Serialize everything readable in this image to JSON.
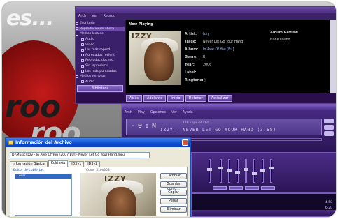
{
  "wallpaper": {
    "text_top": "es...",
    "text_mid": "roo",
    "text_low": "roo"
  },
  "player": {
    "menu": [
      "Arch",
      "Ver",
      "Reprod"
    ],
    "tree": [
      "Escritorio",
      "Reproduciendo ahora",
      "Medios locales",
      "Audio",
      "Vídeo",
      "Los más reprod.",
      "Agregados recient.",
      "Reproducidos rec.",
      "Sin reproducir",
      "Los más puntuados",
      "Medios remotos",
      "Audio"
    ],
    "tree_button": "Biblioteca",
    "now_playing": "Now Playing",
    "cover_title": "IZZY",
    "info": [
      {
        "k": "Artist:",
        "v": "Izzy"
      },
      {
        "k": "Track:",
        "v": "Never Let Go Your Hand"
      },
      {
        "k": "Album:",
        "v": "In Awe Of You [Bu]"
      },
      {
        "k": "Genre:",
        "v": "R"
      },
      {
        "k": "Year:",
        "v": "2006"
      },
      {
        "k": "Label:",
        "v": ""
      },
      {
        "k": "Ringtone:",
        "v": ""
      }
    ],
    "review_label": "Album Review",
    "review_value": "None Found",
    "controls": [
      "Atrás",
      "Adelante",
      "Inicio",
      "Detener",
      "Actualizar"
    ]
  },
  "winamp": {
    "menu": [
      "Arch",
      "Play",
      "Opciones",
      "Ver",
      "Ayuda"
    ],
    "time": "-0:N",
    "kbps": "128 kbps  44 khz",
    "marquee": "IZZY - NEVER LET GO YOUR HAND  (3:58)"
  },
  "playlist": {
    "t1": "6:20",
    "t2": "4:58"
  },
  "dialog": {
    "title": "Información del Archivo",
    "path": "D:\\Music\\Izzy - In Awe Of You [2007 EU] - Never Let Go Your Hand.mp3",
    "tabs": [
      "Información Básica",
      "Cubierta",
      "ID3v1",
      "ID3v2"
    ],
    "active_tab": 1,
    "group_label": "Editor de cubiertas",
    "list_items": [
      "Cover"
    ],
    "preview_label": "Cover 310x308",
    "preview_title": "IZZY",
    "buttons": [
      "Cambiar",
      "Guardar como...",
      "Copiar",
      "Pegar",
      "Eliminar"
    ]
  }
}
